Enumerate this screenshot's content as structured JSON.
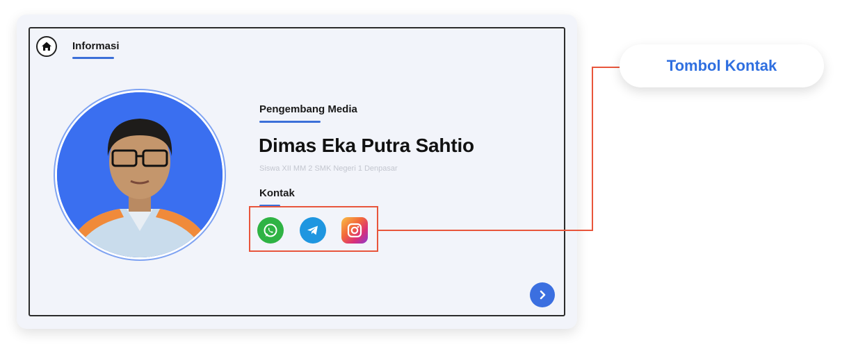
{
  "header": {
    "home_icon": "home-icon",
    "tab_label": "Informasi",
    "accent_color": "#3b6fd8"
  },
  "profile": {
    "role": "Pengembang Media",
    "name": "Dimas Eka Putra Sahtio",
    "subtitle": "Siswa XII MM 2 SMK Negeri 1 Denpasar",
    "photo_background": "#3a6ff0"
  },
  "contact": {
    "label": "Kontak",
    "icons": [
      "whatsapp-icon",
      "telegram-icon",
      "instagram-icon"
    ],
    "highlight_color": "#e8553b"
  },
  "navigation": {
    "next_icon": "chevron-right-icon"
  },
  "callout": {
    "label": "Tombol Kontak",
    "color": "#2f6fe0"
  }
}
